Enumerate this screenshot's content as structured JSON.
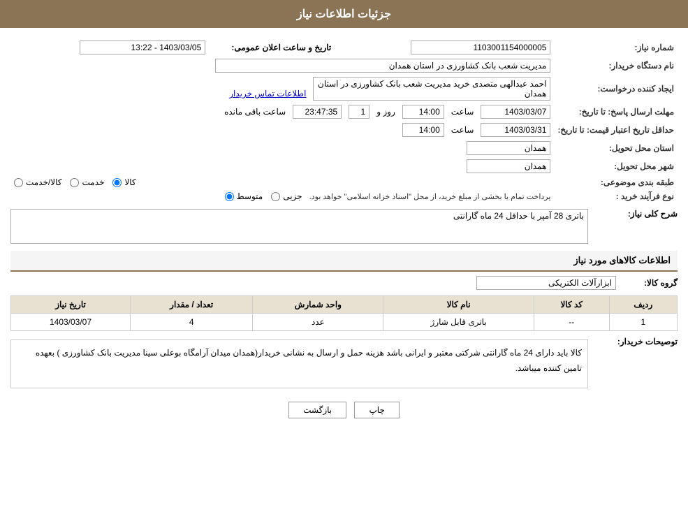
{
  "header": {
    "title": "جزئیات اطلاعات نیاز"
  },
  "form": {
    "shomareNiaz_label": "شماره نیاز:",
    "shomareNiaz_value": "1103001154000005",
    "namDastgah_label": "نام دستگاه خریدار:",
    "namDastgah_value": "مدیریت شعب بانک کشاورزی در استان همدان",
    "tarikhAelan_label": "تاریخ و ساعت اعلان عمومی:",
    "tarikhAelan_value": "1403/03/05 - 13:22",
    "ijadKonande_label": "ایجاد کننده درخواست:",
    "ijadKonande_value": "احمد عبدالهی متصدی خرید مدیریت شعب بانک کشاورزی در استان همدان",
    "ettelaatTamas_text": "اطلاعات تماس خریدار",
    "mohlatErsalPasokh_label": "مهلت ارسال پاسخ: تا تاریخ:",
    "mohlatErsalPasokh_date": "1403/03/07",
    "mohlatErsalPasokh_saatLabel": "ساعت",
    "mohlatErsalPasokh_saat": "14:00",
    "mohlatErsalPasokh_rozLabel": "روز و",
    "mohlatErsalPasokh_roz": "1",
    "mohlatErsalPasokh_baghiLabel": "ساعت باقی مانده",
    "mohlatErsalPasokh_baghi": "23:47:35",
    "haadaqalTarikh_label": "حداقل تاریخ اعتبار قیمت: تا تاریخ:",
    "haadaqalTarikh_date": "1403/03/31",
    "haadaqalTarikh_saatLabel": "ساعت",
    "haadaqalTarikh_saat": "14:00",
    "ostan_label": "استان محل تحویل:",
    "ostan_value": "همدان",
    "shahr_label": "شهر محل تحویل:",
    "shahr_value": "همدان",
    "tabaghebandi_label": "طبقه بندی موضوعی:",
    "tabaghebandi_options": [
      {
        "label": "کالا",
        "selected": true
      },
      {
        "label": "خدمت",
        "selected": false
      },
      {
        "label": "کالا/خدمت",
        "selected": false
      }
    ],
    "noeFarayand_label": "نوع فرآیند خرید :",
    "noeFarayand_options": [
      {
        "label": "جزیی",
        "selected": false
      },
      {
        "label": "متوسط",
        "selected": true
      }
    ],
    "noeFarayand_desc": "پرداخت تمام یا بخشی از مبلغ خرید، از محل \"اسناد خزانه اسلامی\" خواهد بود.",
    "sharhKoli_label": "شرح کلی نیاز:",
    "sharhKoli_value": "باتری 28 آمپر با حداقل 24 ماه گارانتی",
    "ettelaatKala_label": "اطلاعات کالاهای مورد نیاز",
    "groupeKala_label": "گروه کالا:",
    "groupeKala_value": "ابزارآلات الکتریکی",
    "table": {
      "headers": [
        "ردیف",
        "کد کالا",
        "نام کالا",
        "واحد شمارش",
        "تعداد / مقدار",
        "تاریخ نیاز"
      ],
      "rows": [
        {
          "radif": "1",
          "kodKala": "--",
          "namKala": "باتری قابل شارژ",
          "vahed": "عدد",
          "tedad": "4",
          "tarikh": "1403/03/07"
        }
      ]
    },
    "description_label": "توصیحات خریدار:",
    "description_value": "کالا باید دارای 24 ماه گارانتی شرکتی معتبر و ایرانی باشد هزینه حمل و ارسال به نشانی خریدار(همدان میدان آرامگاه بوعلی سینا مدیریت بانک کشاورزی ) بعهده تامین کننده میباشد.",
    "btn_chap": "چاپ",
    "btn_bazgasht": "بازگشت"
  }
}
